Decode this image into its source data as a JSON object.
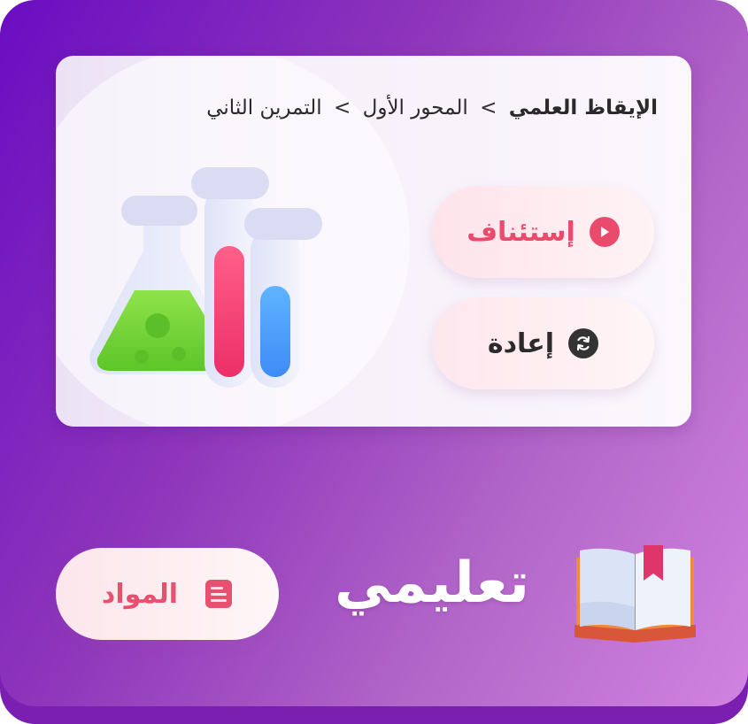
{
  "breadcrumb": {
    "subject": "الإيقاظ العلمي",
    "separator": ">",
    "axis": "المحور الأول",
    "exercise": "التمرين الثاني"
  },
  "actions": {
    "resume_label": "إستئناف",
    "restart_label": "إعادة"
  },
  "footer": {
    "brand": "تعليمي",
    "materials_label": "المواد"
  },
  "icons": {
    "resume": "play-icon",
    "restart": "refresh-icon",
    "materials": "document-icon",
    "logo": "open-book-icon",
    "illustration": "lab-flasks-icon"
  },
  "colors": {
    "accent": "#ea4b6d",
    "dark": "#333333",
    "background_start": "#6a0dc2",
    "background_end": "#d083e0"
  }
}
